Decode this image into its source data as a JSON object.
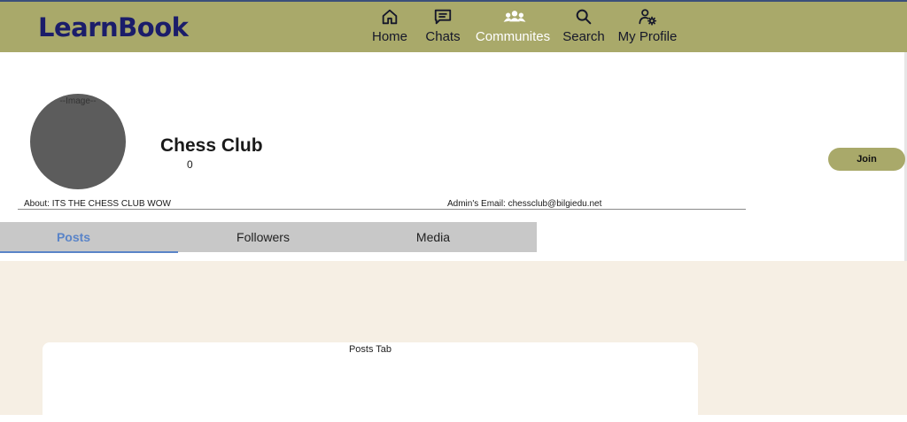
{
  "app": {
    "logo": "LearnBook"
  },
  "nav": {
    "items": [
      {
        "label": "Home",
        "icon": "home-icon"
      },
      {
        "label": "Chats",
        "icon": "chat-icon"
      },
      {
        "label": "Communites",
        "icon": "community-icon",
        "active": true
      },
      {
        "label": "Search",
        "icon": "search-icon"
      },
      {
        "label": "My Profile",
        "icon": "profile-settings-icon"
      }
    ]
  },
  "club": {
    "image_alt": "--Image--",
    "name": "Chess Club",
    "member_count": "0",
    "join_label": "Join",
    "about": "About: ITS THE CHESS CLUB WOW",
    "admin_email": "Admin's Email: chessclub@bilgiedu.net"
  },
  "tabs": [
    {
      "label": "Posts",
      "active": true
    },
    {
      "label": "Followers"
    },
    {
      "label": "Media"
    }
  ],
  "content": {
    "card_title": "Posts Tab"
  },
  "colors": {
    "navbar": "#a9a96a",
    "logo": "#1b1d6a",
    "active_tab": "#5a84c8",
    "content_bg": "#f6efe4",
    "avatar": "#5c5c5c"
  }
}
